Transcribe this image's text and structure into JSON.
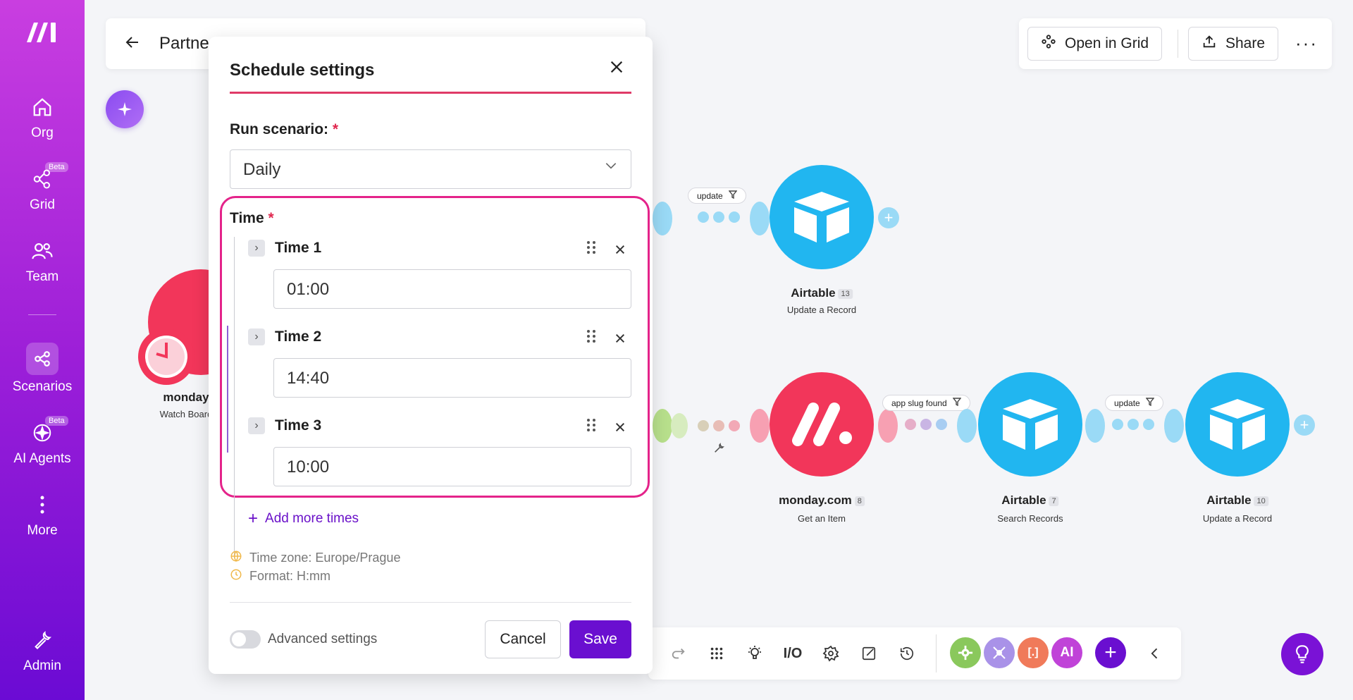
{
  "sidebar": {
    "items": [
      {
        "label": "Org",
        "icon": "home-icon"
      },
      {
        "label": "Grid",
        "icon": "grid-nodes-icon",
        "badge": "Beta"
      },
      {
        "label": "Team",
        "icon": "team-icon"
      },
      {
        "label": "Scenarios",
        "icon": "share-nodes-icon",
        "active": true
      },
      {
        "label": "AI Agents",
        "icon": "ai-agents-icon",
        "badge": "Beta"
      },
      {
        "label": "More",
        "icon": "more-vertical-icon"
      },
      {
        "label": "Admin",
        "icon": "wrench-icon"
      }
    ]
  },
  "header": {
    "title": "Partne",
    "open_in_grid": "Open in Grid",
    "share": "Share"
  },
  "canvas": {
    "filters": {
      "top": "update",
      "bottom1": "app slug found",
      "bottom2": "update"
    },
    "nodes": {
      "monday_trigger": {
        "label": "monday",
        "sub": "Watch Board"
      },
      "airtable13": {
        "label": "Airtable",
        "count": "13",
        "sub": "Update a Record"
      },
      "monday8": {
        "label": "monday.com",
        "count": "8",
        "sub": "Get an Item"
      },
      "airtable7": {
        "label": "Airtable",
        "count": "7",
        "sub": "Search Records"
      },
      "airtable10": {
        "label": "Airtable",
        "count": "10",
        "sub": "Update a Record"
      }
    }
  },
  "bottom_bar": {
    "io_label": "I/O",
    "ai_label": "AI"
  },
  "modal": {
    "title": "Schedule settings",
    "run_label": "Run scenario:",
    "required_mark": "*",
    "run_value": "Daily",
    "time_label": "Time",
    "times": [
      {
        "label": "Time 1",
        "value": "01:00"
      },
      {
        "label": "Time 2",
        "value": "14:40"
      },
      {
        "label": "Time 3",
        "value": "10:00"
      }
    ],
    "add_more": "Add more times",
    "timezone": "Time zone: Europe/Prague",
    "format": "Format: H:mm",
    "advanced": "Advanced settings",
    "cancel": "Cancel",
    "save": "Save"
  },
  "colors": {
    "sidebar_top": "#c93ee0",
    "sidebar_bottom": "#6b0bd4",
    "airtable": "#21b6f0",
    "monday": "#f2365a",
    "accent_underline": "#e03a67",
    "highlight_box": "#e4238a",
    "primary": "#6a0fd0"
  }
}
